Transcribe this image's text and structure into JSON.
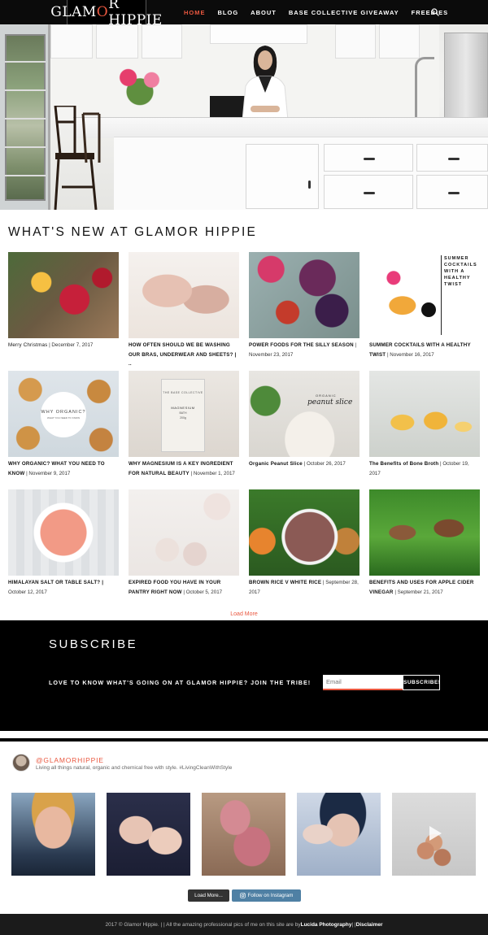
{
  "header": {
    "logo_left": "GLAM",
    "logo_o": "O",
    "logo_right": "R HIPPIE",
    "nav": [
      "HOME",
      "BLOG",
      "ABOUT",
      "BASE COLLECTIVE GIVEAWAY",
      "FREEBIES"
    ],
    "active": "HOME"
  },
  "section": {
    "title": "WHAT'S NEW AT GLAMOR HIPPIE"
  },
  "posts": [
    {
      "title": "Merry Christmas",
      "date": " | December 7, 2017"
    },
    {
      "title": "HOW OFTEN SHOULD WE BE WASHING OUR BRAS, UNDERWEAR AND SHEETS? | ..",
      "date": ""
    },
    {
      "title": "POWER FOODS FOR THE SILLY SEASON",
      "date": " | November 23, 2017"
    },
    {
      "title": "SUMMER COCKTAILS WITH A HEALTHY TWIST",
      "date": " | November 16, 2017"
    },
    {
      "title": "WHY ORGANIC? WHAT YOU NEED TO KNOW",
      "date": " | November 9, 2017"
    },
    {
      "title": "WHY MAGNESIUM IS A KEY INGREDIENT FOR NATURAL BEAUTY",
      "date": " | November 1, 2017"
    },
    {
      "title": "Organic Peanut Slice",
      "date": " | October 26, 2017"
    },
    {
      "title": "The Benefits of Bone Broth",
      "date": " | October 19, 2017"
    },
    {
      "title": "HIMALAYAN SALT OR TABLE SALT? |",
      "date": " October 12, 2017"
    },
    {
      "title": "EXPIRED FOOD YOU HAVE IN YOUR PANTRY RIGHT NOW",
      "date": " | October 5, 2017"
    },
    {
      "title": "BROWN RICE V WHITE RICE",
      "date": " | September 28, 2017"
    },
    {
      "title": "BENEFITS AND USES FOR APPLE CIDER VINEGAR",
      "date": " | September 21, 2017"
    }
  ],
  "thumb_text": {
    "cocktail_card": "SUMMER COCKTAILS WITH A HEALTHY TWIST",
    "organic_badge": "WHY ORGANIC?",
    "organic_sub": "WHAT YOU NEED TO KNOW",
    "magnesium_brand": "THE BASE COLLECTIVE",
    "magnesium_label": "MAGNESIUM",
    "magnesium_sub": "BATH",
    "magnesium_weight": "200g",
    "peanut_organic": "ORGANIC",
    "peanut_title": "peanut slice"
  },
  "load_more": "Load More",
  "subscribe": {
    "title": "SUBSCRIBE",
    "text": "LOVE TO KNOW WHAT'S GOING ON AT GLAMOR HIPPIE? JOIN THE TRIBE!",
    "email_placeholder": "Email",
    "button": "SUBSCRIBE!"
  },
  "instagram": {
    "handle": "@GLAMORHIPPIE",
    "bio": "Living all things natural, organic and chemical free with style. #LivingCleanWithStyle",
    "load_more": "Load More...",
    "follow": "Follow on Instagram"
  },
  "footer": {
    "text_left": "2017 © Glamor Hippie. | | All the amazing professional pics of me on this site are by ",
    "photographer": "Lucida Photography",
    "sep": " | | ",
    "disclaimer": "Disclaimer"
  },
  "colors": {
    "accent": "#e9573f",
    "nav_bg": "#0b0b0b",
    "instagram_blue": "#4f80a4",
    "footer_bg": "#1b1b1b"
  }
}
